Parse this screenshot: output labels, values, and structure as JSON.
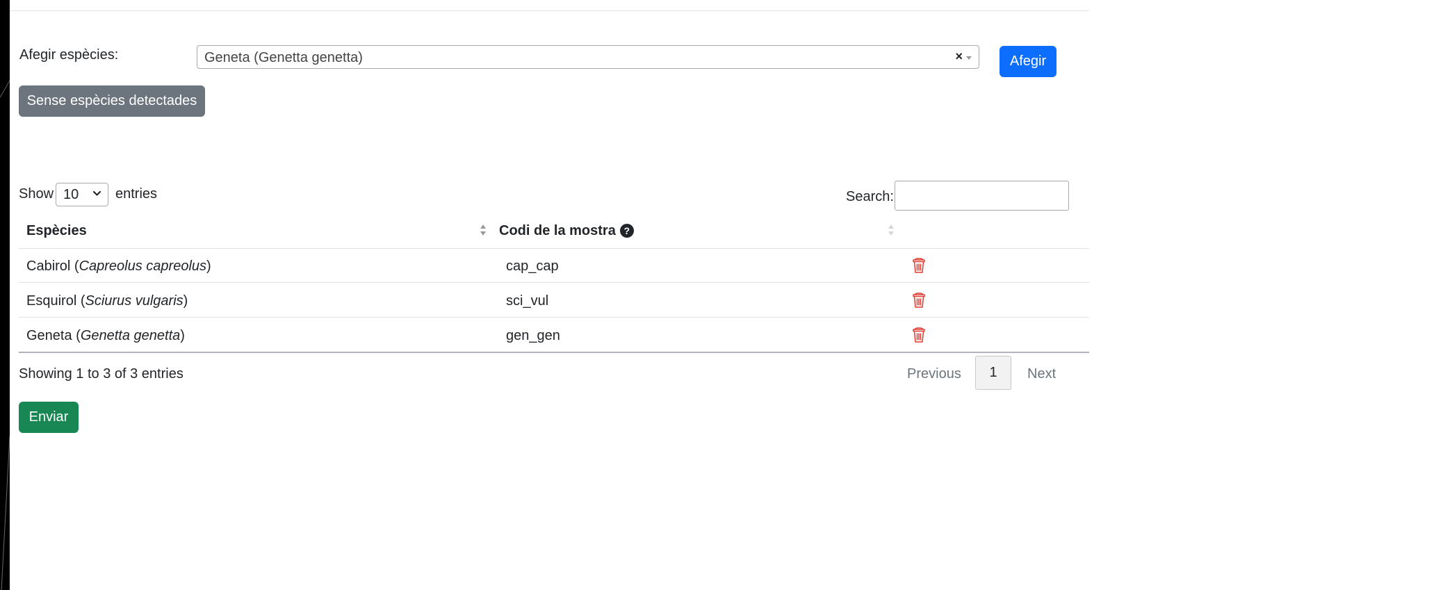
{
  "form": {
    "add_label": "Afegir espècies:",
    "select_value": "Geneta (Genetta genetta)",
    "clear_symbol": "×",
    "add_button": "Afegir",
    "no_species_button": "Sense espècies detectades"
  },
  "table_controls": {
    "show_label": "Show",
    "entries_label": "entries",
    "page_length": "10",
    "search_label": "Search:",
    "search_value": ""
  },
  "table": {
    "columns": [
      {
        "label": "Espècies",
        "sort": "active"
      },
      {
        "label": "Codi de la mostra",
        "help_symbol": "?",
        "sort": "inactive"
      }
    ],
    "rows": [
      {
        "common": "Cabirol",
        "open": " (",
        "scientific": "Capreolus capreolus",
        "close": ")",
        "code": "cap_cap"
      },
      {
        "common": "Esquirol",
        "open": " (",
        "scientific": "Sciurus vulgaris",
        "close": ")",
        "code": "sci_vul"
      },
      {
        "common": "Geneta",
        "open": " (",
        "scientific": "Genetta genetta",
        "close": ")",
        "code": "gen_gen"
      }
    ],
    "delete_icon": "trash-icon"
  },
  "pagination": {
    "info": "Showing 1 to 3 of 3 entries",
    "previous": "Previous",
    "current": "1",
    "next": "Next"
  },
  "submit_button": "Enviar",
  "colors": {
    "primary": "#0d6efd",
    "secondary": "#6c757d",
    "success": "#198754",
    "danger": "#e03c31"
  }
}
